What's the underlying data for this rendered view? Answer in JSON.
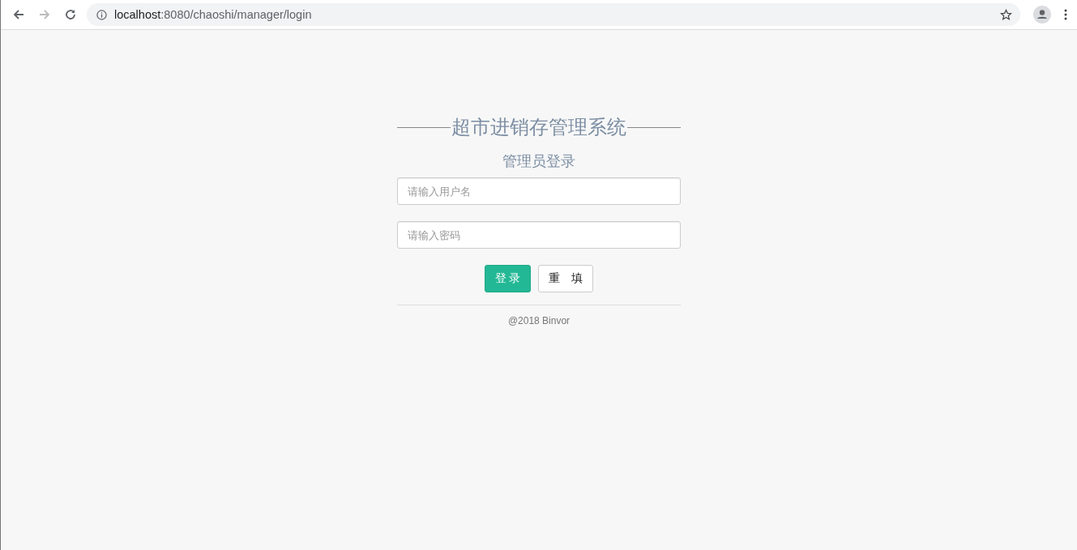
{
  "browser": {
    "url_host": "localhost",
    "url_path": ":8080/chaoshi/manager/login",
    "back_disabled": false,
    "forward_disabled": true
  },
  "login": {
    "title": "超市进销存管理系统",
    "subtitle": "管理员登录",
    "fields": [
      {
        "placeholder": "请输入用户名"
      },
      {
        "placeholder": "请输入密码"
      }
    ],
    "buttons": [
      {
        "label": "登 录",
        "kind": "primary"
      },
      {
        "label": "重　填",
        "kind": "default"
      }
    ],
    "footer": "@2018 Binvor"
  }
}
